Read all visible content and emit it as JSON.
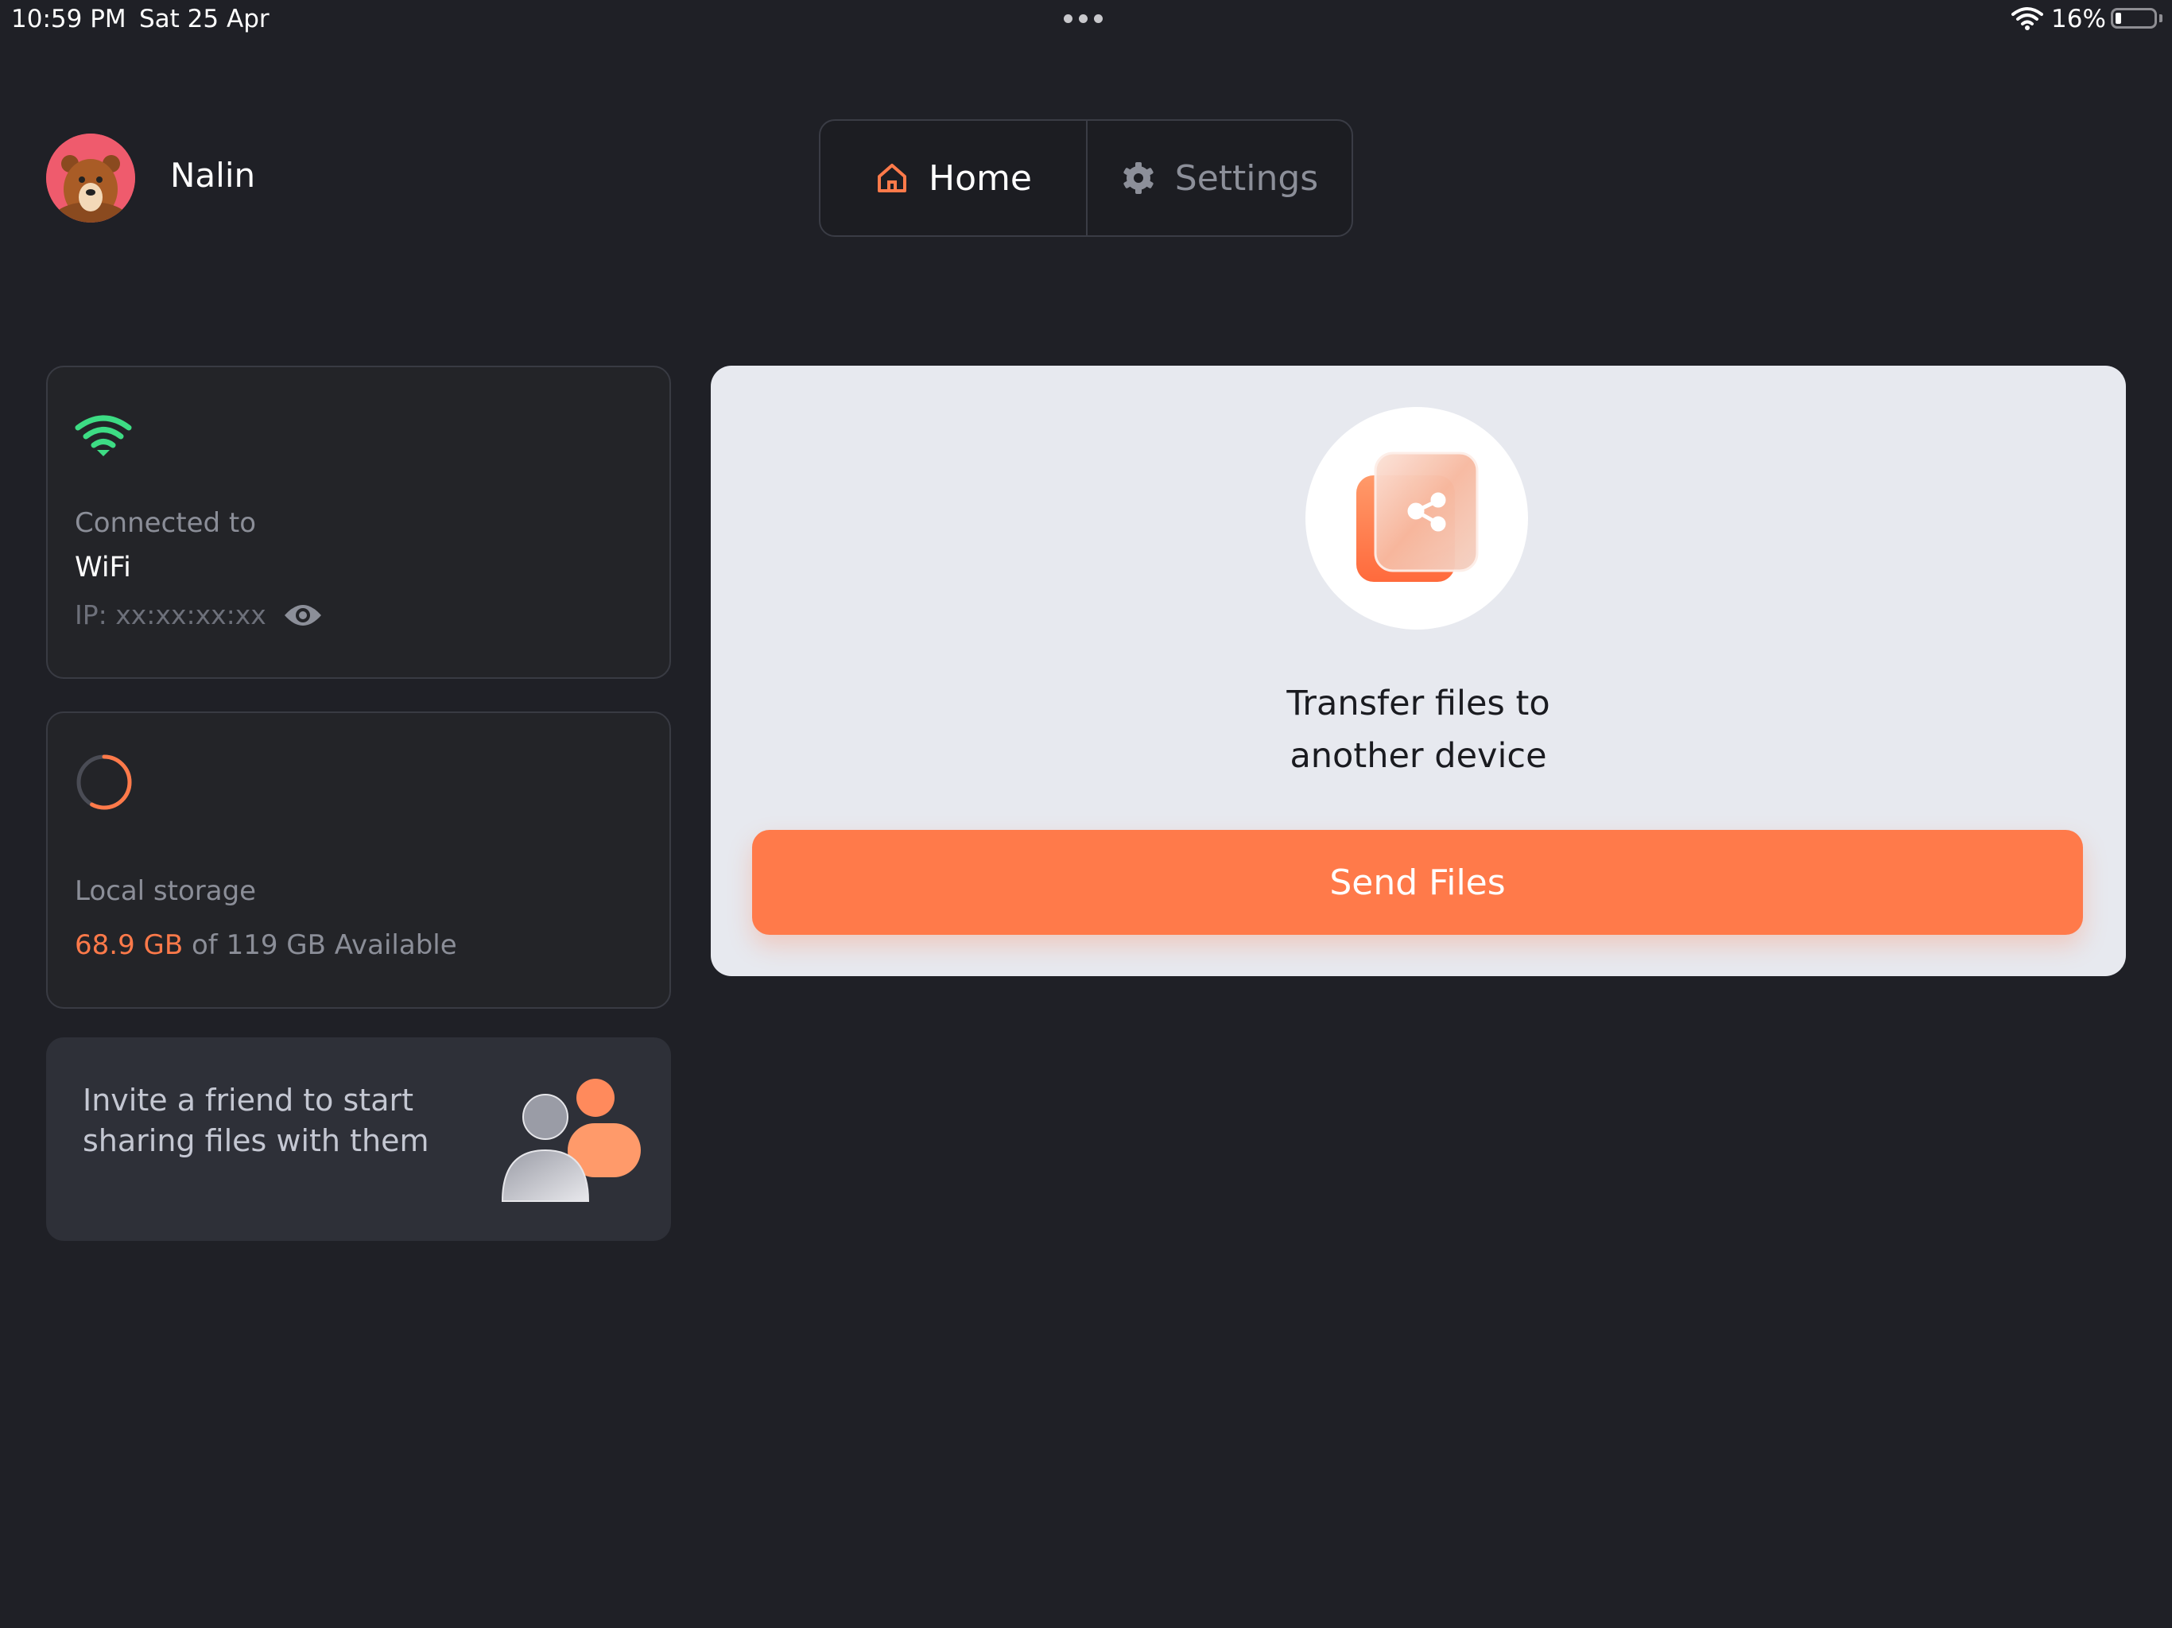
{
  "status_bar": {
    "time": "10:59 PM",
    "date": "Sat 25 Apr",
    "battery_percent": "16%",
    "battery_level": 0.16
  },
  "user": {
    "name": "Nalin",
    "avatar_icon": "bear-avatar-icon"
  },
  "nav": {
    "tabs": [
      {
        "label": "Home",
        "icon": "home-icon",
        "active": true
      },
      {
        "label": "Settings",
        "icon": "gear-icon",
        "active": false
      }
    ]
  },
  "connection": {
    "label": "Connected to",
    "network": "WiFi",
    "ip": "IP: xx:xx:xx:xx",
    "status_color": "#3ddc84"
  },
  "storage": {
    "label": "Local storage",
    "used": "68.9 GB",
    "rest": " of 119 GB Available"
  },
  "invite": {
    "text": "Invite a friend to start sharing files with them"
  },
  "transfer": {
    "title_line1": "Transfer files to",
    "title_line2": "another device",
    "button_label": "Send Files"
  },
  "colors": {
    "accent": "#ff7a4a",
    "background": "#1f2026",
    "card": "#232428",
    "panel": "#e7e9ef"
  }
}
